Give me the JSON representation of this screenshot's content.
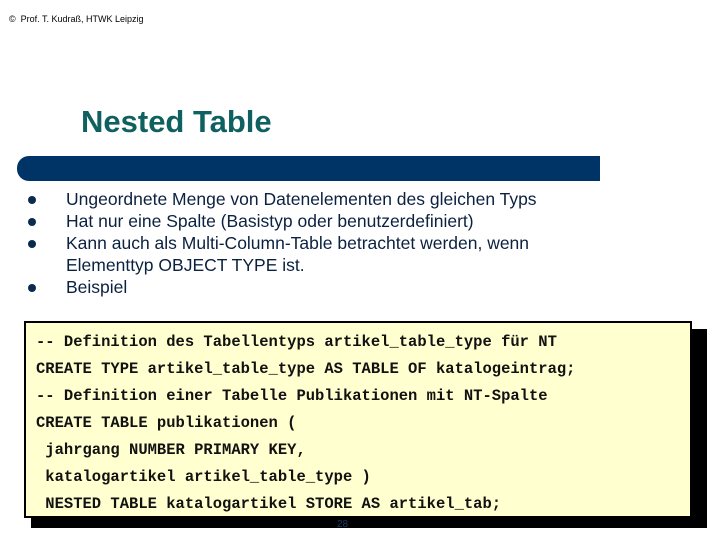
{
  "header": {
    "copyright_symbol": "©",
    "copyright_text": "Prof. T. Kudraß, HTWK Leipzig"
  },
  "slide": {
    "title": "Nested Table",
    "colors": {
      "title": "#0f6060",
      "title_bar": "#003366",
      "bullet_text": "#0b2140",
      "code_background": "#ffffd0"
    },
    "bullets": [
      {
        "text": "Ungeordnete Menge von Datenelementen des gleichen Typs"
      },
      {
        "text": "Hat nur eine Spalte (Basistyp oder benutzerdefiniert)"
      },
      {
        "text": "Kann auch als Multi-Column-Table betrachtet werden, wenn Elementtyp OBJECT TYPE ist."
      },
      {
        "text": "Beispiel"
      }
    ],
    "code_lines": [
      "-- Definition des Tabellentyps artikel_table_type für NT",
      "CREATE TYPE artikel_table_type AS TABLE OF katalogeintrag;",
      "-- Definition einer Tabelle Publikationen mit NT-Spalte",
      "CREATE TABLE publikationen (",
      " jahrgang NUMBER PRIMARY KEY,",
      " katalogartikel artikel_table_type )",
      " NESTED TABLE katalogartikel STORE AS artikel_tab;"
    ],
    "page_number": "28"
  }
}
